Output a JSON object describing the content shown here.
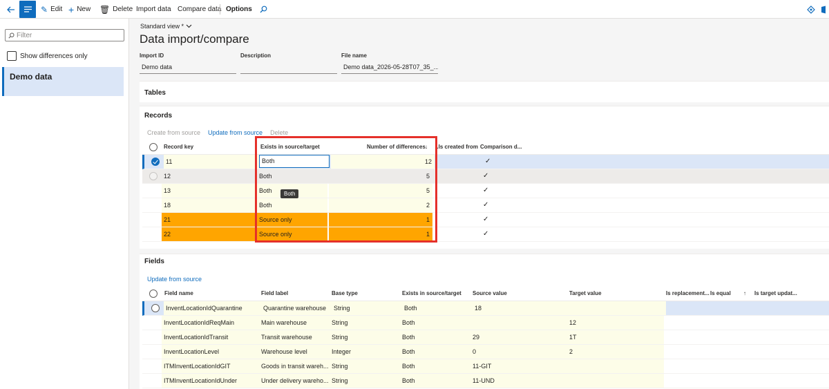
{
  "toolbar": {
    "edit": "Edit",
    "new": "New",
    "delete": "Delete",
    "import_data": "Import data",
    "compare_data": "Compare data",
    "options": "Options"
  },
  "filter": {
    "placeholder": "Filter"
  },
  "left": {
    "show_differences": "Show differences only",
    "items": [
      {
        "label": "Demo data"
      }
    ]
  },
  "header": {
    "view_selector": "Standard view *",
    "title": "Data import/compare",
    "fields": [
      {
        "label": "Import ID",
        "value": "Demo data"
      },
      {
        "label": "Description",
        "value": ""
      },
      {
        "label": "File name",
        "value": "Demo data_2026-05-28T07_35_..."
      }
    ]
  },
  "tables_section": {
    "title": "Tables"
  },
  "records": {
    "title": "Records",
    "actions": [
      {
        "label": "Create from source",
        "enabled": false
      },
      {
        "label": "Update from source",
        "enabled": true
      },
      {
        "label": "Delete",
        "enabled": false
      }
    ],
    "columns": {
      "record_key": "Record key",
      "exists": "Exists in source/target",
      "num_diff": "Number of differences",
      "is_created": "Is created from...",
      "comparison": "Comparison d..."
    },
    "sort_indicator": "↓",
    "rows": [
      {
        "key": "11",
        "exists": "Both",
        "diffs": "12",
        "check": "✓",
        "state": "selected"
      },
      {
        "key": "12",
        "exists": "Both",
        "diffs": "5",
        "check": "✓",
        "state": "hover"
      },
      {
        "key": "13",
        "exists": "Both",
        "diffs": "5",
        "check": "✓",
        "state": "normal"
      },
      {
        "key": "18",
        "exists": "Both",
        "diffs": "2",
        "check": "✓",
        "state": "normal"
      },
      {
        "key": "21",
        "exists": "Source only",
        "diffs": "1",
        "check": "✓",
        "state": "orange"
      },
      {
        "key": "22",
        "exists": "Source only",
        "diffs": "1",
        "check": "✓",
        "state": "orange"
      }
    ],
    "tooltip": "Both"
  },
  "fields": {
    "title": "Fields",
    "actions": [
      {
        "label": "Update from source",
        "enabled": true
      }
    ],
    "columns": {
      "field_name": "Field name",
      "field_label": "Field label",
      "base_type": "Base type",
      "exists": "Exists in source/target",
      "source_value": "Source value",
      "target_value": "Target value",
      "is_replacement": "Is replacement...",
      "is_equal": "Is equal",
      "is_target_updated": "Is target updat..."
    },
    "sort_indicator": "↑",
    "rows": [
      {
        "name": "InventLocationIdQuarantine",
        "label": "Quarantine warehouse",
        "type": "String",
        "exists": "Both",
        "source": "18",
        "target": ""
      },
      {
        "name": "InventLocationIdReqMain",
        "label": "Main warehouse",
        "type": "String",
        "exists": "Both",
        "source": "",
        "target": "12"
      },
      {
        "name": "InventLocationIdTransit",
        "label": "Transit warehouse",
        "type": "String",
        "exists": "Both",
        "source": "29",
        "target": "1T"
      },
      {
        "name": "InventLocationLevel",
        "label": "Warehouse level",
        "type": "Integer",
        "exists": "Both",
        "source": "0",
        "target": "2"
      },
      {
        "name": "ITMInventLocationIdGIT",
        "label": "Goods in transit wareh...",
        "type": "String",
        "exists": "Both",
        "source": "11-GIT",
        "target": ""
      },
      {
        "name": "ITMInventLocationIdUnder",
        "label": "Under delivery wareho...",
        "type": "String",
        "exists": "Both",
        "source": "11-UND",
        "target": ""
      }
    ]
  },
  "colors": {
    "accent": "#0f6cbd",
    "yellow_cell": "#fdfde8",
    "orange_row": "#ffa500",
    "selected_row": "#dbe6f7",
    "hover_row": "#edebe9",
    "highlight_box": "#e5302a"
  }
}
